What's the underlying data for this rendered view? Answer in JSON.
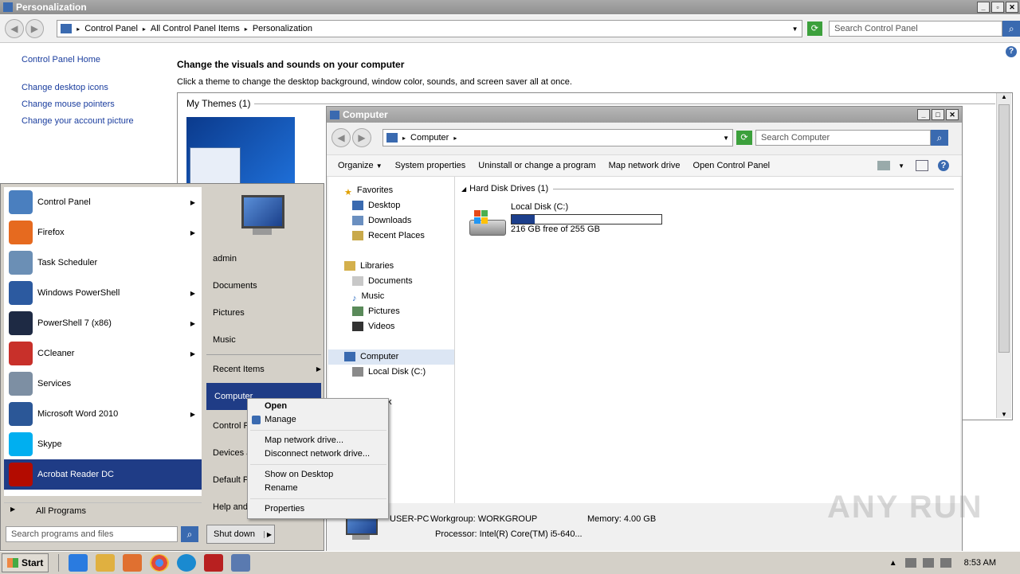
{
  "window": {
    "title": "Personalization"
  },
  "address": {
    "parts": [
      "Control Panel",
      "All Control Panel Items",
      "Personalization"
    ]
  },
  "search": {
    "placeholder": "Search Control Panel"
  },
  "left_links": [
    "Control Panel Home",
    "Change desktop icons",
    "Change mouse pointers",
    "Change your account picture"
  ],
  "main": {
    "title": "Change the visuals and sounds on your computer",
    "subtitle": "Click a theme to change the desktop background, window color, sounds, and screen saver all at once.",
    "themes_header": "My Themes (1)"
  },
  "explorer": {
    "title": "Computer",
    "address": "Computer",
    "search": "Search Computer",
    "toolbar": [
      "Organize",
      "System properties",
      "Uninstall or change a program",
      "Map network drive",
      "Open Control Panel"
    ],
    "nav": {
      "favorites": "Favorites",
      "favorites_items": [
        "Desktop",
        "Downloads",
        "Recent Places"
      ],
      "libraries": "Libraries",
      "libraries_items": [
        "Documents",
        "Music",
        "Pictures",
        "Videos"
      ],
      "computer": "Computer",
      "computer_items": [
        "Local Disk (C:)"
      ],
      "network_partial": "k"
    },
    "section": "Hard Disk Drives (1)",
    "drive": {
      "name": "Local Disk (C:)",
      "free_text": "216 GB free of 255 GB",
      "used_fraction": 0.153
    },
    "details": {
      "name": "USER-PC",
      "workgroup": "Workgroup: WORKGROUP",
      "memory": "Memory: 4.00 GB",
      "processor": "Processor: Intel(R) Core(TM) i5-640..."
    }
  },
  "start_menu": {
    "programs": [
      {
        "label": "Control Panel",
        "arrow": true,
        "color": "#4a7fbf"
      },
      {
        "label": "Firefox",
        "arrow": true,
        "color": "#e66a1f"
      },
      {
        "label": "Task Scheduler",
        "arrow": false,
        "color": "#6b8fb5"
      },
      {
        "label": "Windows PowerShell",
        "arrow": true,
        "color": "#2c5aa0"
      },
      {
        "label": "PowerShell 7 (x86)",
        "arrow": true,
        "color": "#1e2a44"
      },
      {
        "label": "CCleaner",
        "arrow": true,
        "color": "#c8302a"
      },
      {
        "label": "Services",
        "arrow": false,
        "color": "#7d8fa3"
      },
      {
        "label": "Microsoft Word 2010",
        "arrow": true,
        "color": "#2b5797"
      },
      {
        "label": "Skype",
        "arrow": false,
        "color": "#00aff0"
      },
      {
        "label": "Acrobat Reader DC",
        "arrow": false,
        "color": "#b30b00"
      }
    ],
    "all_programs": "All Programs",
    "search_placeholder": "Search programs and files",
    "shutdown": "Shut down",
    "right_items": [
      "admin",
      "Documents",
      "Pictures",
      "Music"
    ],
    "recent_items": "Recent Items",
    "computer": "Computer",
    "lower_items": [
      "Control P",
      "Devices a",
      "Default P",
      "Help and"
    ]
  },
  "context_menu": {
    "open": "Open",
    "manage": "Manage",
    "map": "Map network drive...",
    "disconnect": "Disconnect network drive...",
    "show": "Show on Desktop",
    "rename": "Rename",
    "properties": "Properties"
  },
  "taskbar": {
    "start": "Start",
    "time": "8:53 AM"
  },
  "watermark": "ANY RUN"
}
